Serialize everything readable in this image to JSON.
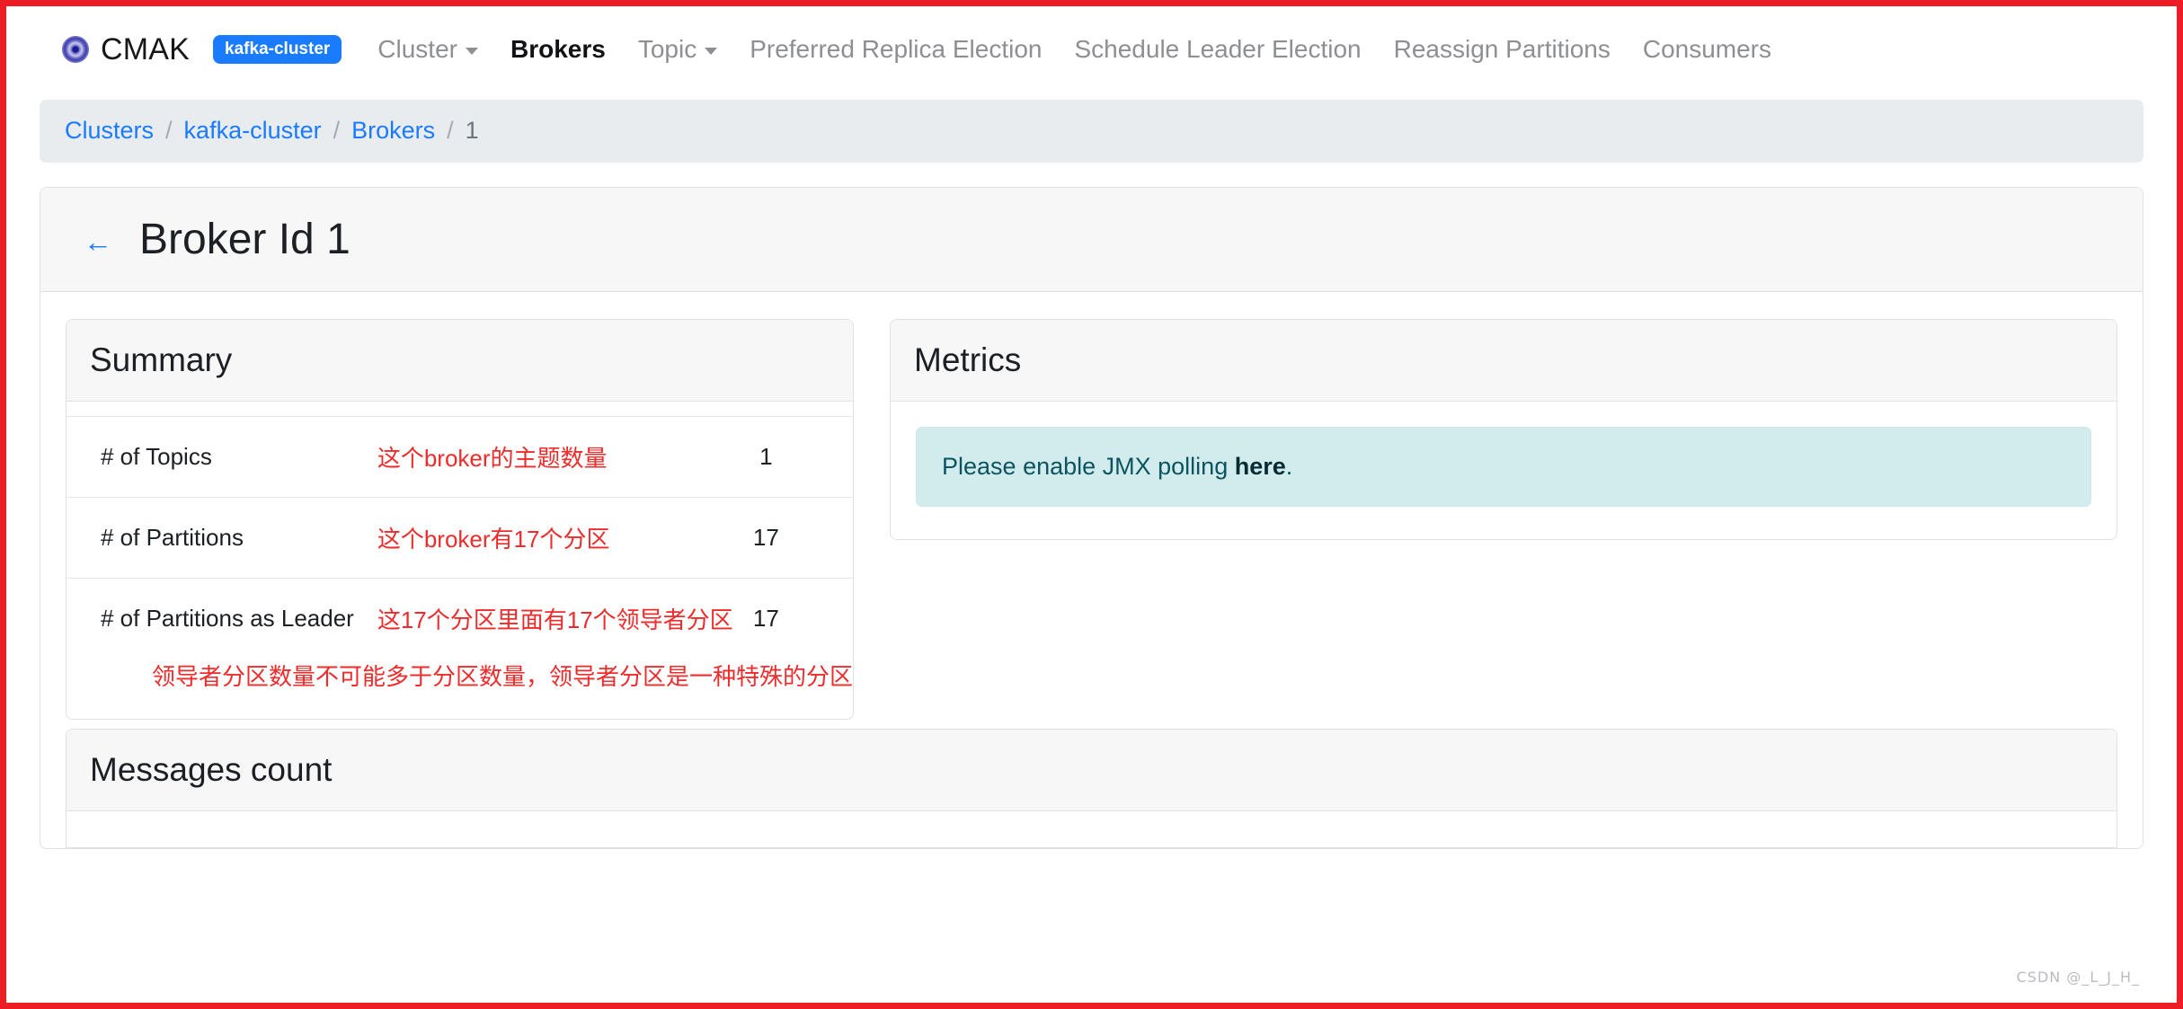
{
  "navbar": {
    "brand": "CMAK",
    "brand_logo_icon": "cmak-target-logo-icon",
    "cluster_badge": "kafka-cluster",
    "items": [
      {
        "label": "Cluster",
        "has_caret": true,
        "active": false
      },
      {
        "label": "Brokers",
        "has_caret": false,
        "active": true
      },
      {
        "label": "Topic",
        "has_caret": true,
        "active": false
      },
      {
        "label": "Preferred Replica Election",
        "has_caret": false,
        "active": false
      },
      {
        "label": "Schedule Leader Election",
        "has_caret": false,
        "active": false
      },
      {
        "label": "Reassign Partitions",
        "has_caret": false,
        "active": false
      },
      {
        "label": "Consumers",
        "has_caret": false,
        "active": false
      }
    ]
  },
  "breadcrumb": {
    "separator": "/",
    "items": [
      {
        "label": "Clusters",
        "current": false
      },
      {
        "label": "kafka-cluster",
        "current": false
      },
      {
        "label": "Brokers",
        "current": false
      },
      {
        "label": "1",
        "current": true
      }
    ]
  },
  "page": {
    "back_arrow": "←",
    "title": "Broker Id 1"
  },
  "summary": {
    "title": "Summary",
    "rows": [
      {
        "label": "# of Topics",
        "note": "这个broker的主题数量",
        "value": "1"
      },
      {
        "label": "# of Partitions",
        "note": "这个broker有17个分区",
        "value": "17"
      },
      {
        "label": "# of Partitions as Leader",
        "note": "这17个分区里面有17个领导者分区",
        "value": "17"
      }
    ],
    "footnote": "领导者分区数量不可能多于分区数量，领导者分区是一种特殊的分区"
  },
  "metrics": {
    "title": "Metrics",
    "alert_prefix": "Please enable JMX polling ",
    "alert_link": "here",
    "alert_suffix": "."
  },
  "messages_count": {
    "title": "Messages count"
  },
  "watermark": "CSDN @_L_J_H_",
  "colors": {
    "frame_red": "#ee1c25",
    "brand_blue": "#1a7bff",
    "annotation_red": "#ef2b2b",
    "alert_bg": "#d2eced",
    "alert_text": "#0c5460",
    "breadcrumb_bg": "#e9ecef",
    "card_head_bg": "#f7f7f8"
  }
}
